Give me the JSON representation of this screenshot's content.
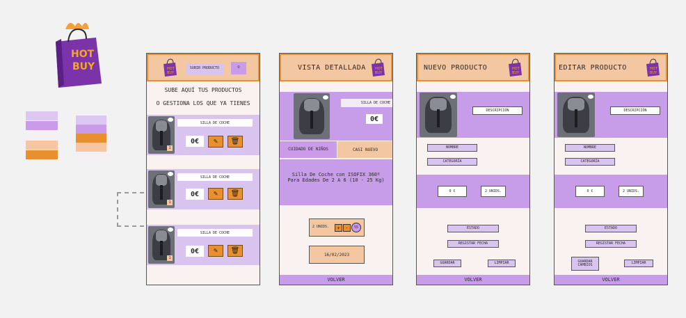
{
  "logo": {
    "text_line1": "HOT",
    "text_line2": "BUY"
  },
  "palette": {
    "colors_a": [
      "#dcc7f2",
      "#c99be8",
      "#f4f0f4",
      "#f5c6a0",
      "#e8902f"
    ],
    "colors_b": [
      "#dcc7f2",
      "#c99be8",
      "#e8902f",
      "#f5c6a0",
      "#f4f0f4"
    ],
    "accent_orange": "#e8902f",
    "accent_purple": "#c79ce8",
    "light_purple": "#d9c3ef",
    "peach": "#f4c7a3"
  },
  "screen1": {
    "upload_button": "SUBIR PRODUCTO",
    "search_icon": "search-icon",
    "intro_line1": "SUBE AQUÍ TUS PRODUCTOS",
    "intro_line2": "O GESTIONA LOS QUE YA TIENES",
    "products": [
      {
        "name": "SILLA DE COCHE",
        "price": "0€",
        "qty": "1"
      },
      {
        "name": "SILLA DE COCHE",
        "price": "0€",
        "qty": "1"
      },
      {
        "name": "SILLA DE COCHE",
        "price": "0€",
        "qty": "1"
      }
    ]
  },
  "screen2": {
    "title": "VISTA DETALLADA",
    "product_name": "SILLA DE COCHE",
    "price": "0€",
    "tag1": "CUIDADO DE NIÑOS",
    "tag2": "CASI NUEVO",
    "description": "Silla De Coche con ISOFIX 360º Para Edades De 2 A 6 (10 - 25 Kg)",
    "qty_label": "2 UNIDS.",
    "qty_plus": "+",
    "qty_minus": "-",
    "qty_value": "55",
    "date": "16/02/2023",
    "back": "VOLVER"
  },
  "screen3": {
    "title": "NUEVO PRODUCTO",
    "description_field": "DESCRIPCIÓN",
    "name_field": "NOMBRE",
    "category_field": "CATEGORÍA",
    "price_field": "0 €",
    "units_field": "2 UNIDS.",
    "state_field": "ESTADO",
    "date_field": "REGISTAR FECHA",
    "save": "GUARDAR",
    "clear": "LIMPIAR",
    "back": "VOLVER"
  },
  "screen4": {
    "title": "EDITAR PRODUCTO",
    "description_field": "DESCRIPCIÓN",
    "name_field": "NOMBRE",
    "category_field": "CATEGORÍA",
    "price_field": "0 €",
    "units_field": "2 UNIDS.",
    "state_field": "ESTADO",
    "date_field": "REGISTAR FECHA",
    "save_line1": "GUARDAR",
    "save_line2": "CAMBIOS",
    "clear": "LIMPIAR",
    "back": "VOLVER"
  }
}
